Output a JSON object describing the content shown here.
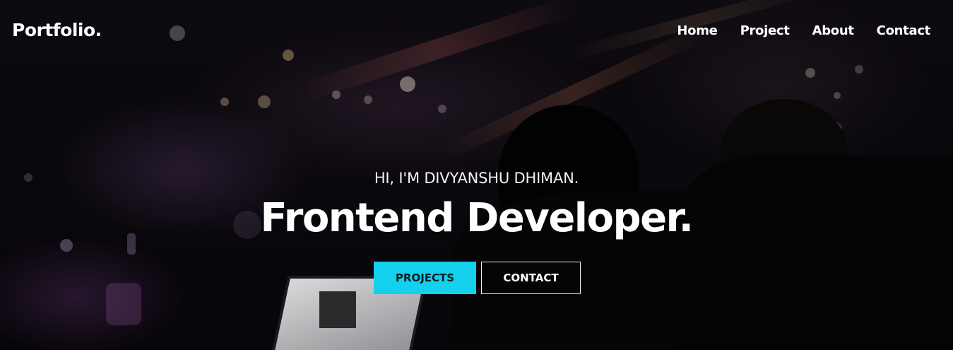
{
  "header": {
    "logo": "Portfolio.",
    "nav": [
      {
        "label": "Home"
      },
      {
        "label": "Project"
      },
      {
        "label": "About"
      },
      {
        "label": "Contact"
      }
    ]
  },
  "hero": {
    "greeting": "HI, I'M DIVYANSHU DHIMAN.",
    "headline": "Frontend Developer.",
    "buttons": {
      "primary": "PROJECTS",
      "secondary": "CONTACT"
    }
  },
  "colors": {
    "accent": "#14d0ec",
    "background": "#050407",
    "text": "#ffffff"
  }
}
